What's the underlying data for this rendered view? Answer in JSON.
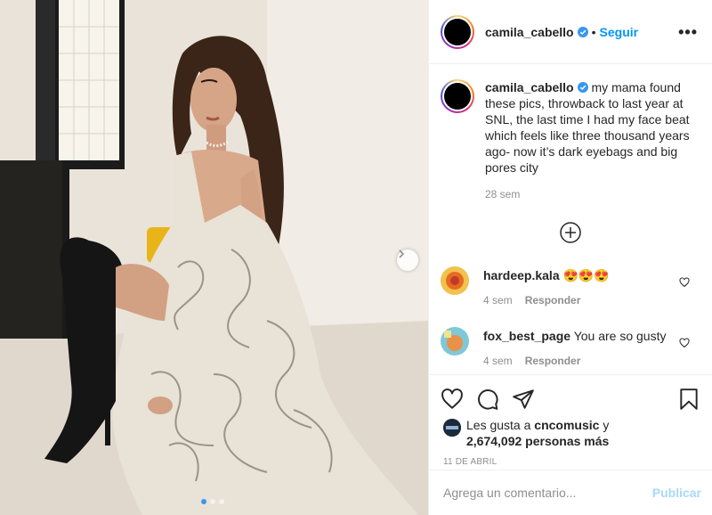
{
  "post": {
    "username": "camila_cabello",
    "separator": "•",
    "follow_label": "Seguir",
    "more_icon": "more-horizontal-icon",
    "caption": "my mama found these pics, throwback to last year at SNL, the last time I had my face beat which feels like three thousand years ago- now it’s dark eyebags and big pores city",
    "caption_time": "28 sem",
    "carousel": {
      "total": 3,
      "current": 1
    }
  },
  "comments": [
    {
      "username": "hardeep.kala",
      "text": "😍😍😍",
      "time": "4 sem",
      "reply_label": "Responder"
    },
    {
      "username": "fox_best_page",
      "text": "You are so gusty",
      "time": "4 sem",
      "reply_label": "Responder"
    }
  ],
  "likes": {
    "prefix": "Les gusta a",
    "liker": "cncomusic",
    "connector": "y",
    "count_text": "2,674,092 personas más"
  },
  "date": "11 DE ABRIL",
  "add_comment": {
    "placeholder": "Agrega un comentario...",
    "publish_label": "Publicar"
  },
  "colors": {
    "accent": "#0095f6",
    "muted": "#8e8e8e",
    "text": "#262626",
    "border": "#efefef"
  }
}
